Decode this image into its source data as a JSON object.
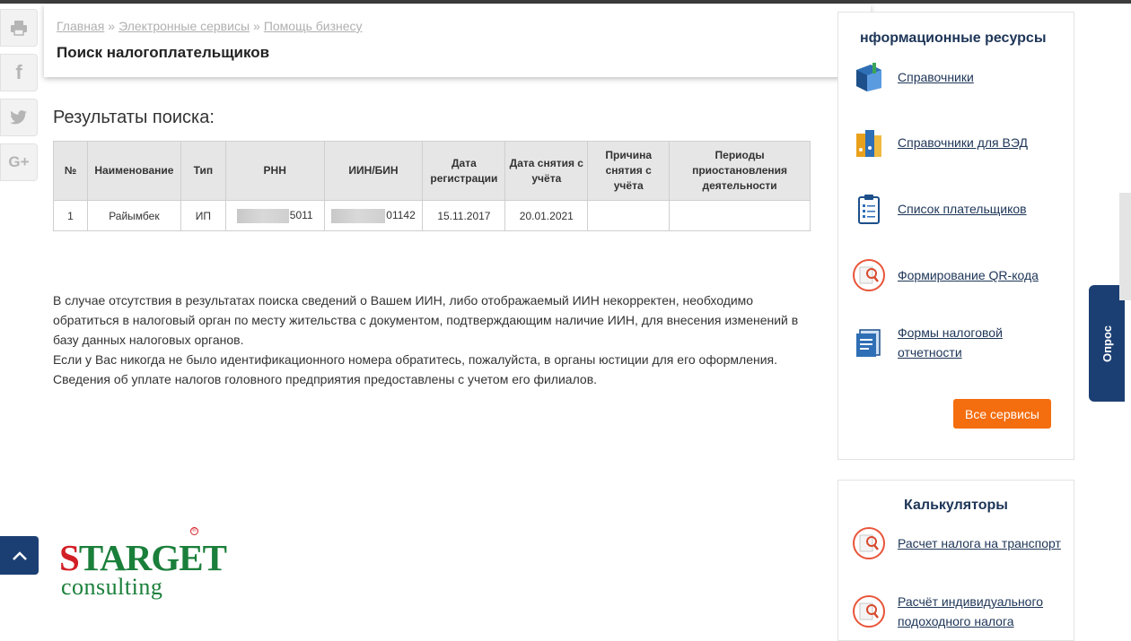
{
  "breadcrumb": {
    "items": [
      "Главная",
      "Электронные сервисы",
      "Помощь бизнесу"
    ],
    "separator": "»"
  },
  "page_title": "Поиск налогоплательщиков",
  "results_heading": "Результаты поиска:",
  "table": {
    "headers": [
      "№",
      "Наименование",
      "Тип",
      "РНН",
      "ИИН/БИН",
      "Дата регистрации",
      "Дата снятия с учёта",
      "Причина снятия с учёта",
      "Периоды приостановления деятельности"
    ],
    "rows": [
      {
        "num": "1",
        "name": "Райымбек",
        "type": "ИП",
        "rnn_visible": "5011",
        "iin_visible": "01142",
        "reg_date": "15.11.2017",
        "dereg_date": "20.01.2021",
        "reason": "",
        "periods": ""
      }
    ]
  },
  "notes": [
    "В случае отсутствия в результатах поиска сведений о Вашем ИИН, либо отображаемый ИИН некорректен, необходимо обратиться в налоговый орган по месту жительства с документом, подтверждающим наличие ИИН, для внесения изменений в базу данных налоговых органов.",
    "Если у Вас никогда не было идентификационного номера обратитесь, пожалуйста, в органы юстиции для его оформления.",
    "Сведения об уплате налогов головного предприятия предоставлены с учетом его филиалов."
  ],
  "sidebar": {
    "info_title": "нформационные ресурсы",
    "info_items": [
      {
        "label": "Справочники",
        "icon": "book-icon"
      },
      {
        "label": "Справочники для ВЭД",
        "icon": "binders-icon"
      },
      {
        "label": "Список плательщиков",
        "icon": "clipboard-icon"
      },
      {
        "label": "Формирование QR-кода",
        "icon": "magnifier-doc-icon"
      },
      {
        "label": "Формы налоговой отчетности",
        "icon": "forms-icon"
      }
    ],
    "all_services_label": "Все сервисы",
    "calc_title": "Калькуляторы",
    "calc_items": [
      {
        "label": "Расчет налога на транспорт",
        "icon": "magnifier-doc-icon"
      },
      {
        "label": "Расчёт индивидуального подоходного налога",
        "icon": "magnifier-doc-icon"
      }
    ]
  },
  "survey_tab": "Опрос",
  "share_icons": [
    "print-icon",
    "facebook-icon",
    "twitter-icon",
    "google-plus-icon"
  ],
  "logo": {
    "main": "STARGET",
    "sub": "consulting",
    "mark": "®"
  },
  "colors": {
    "navy": "#1c3f73",
    "orange": "#f46d0e",
    "link": "#1d3557",
    "logo_green": "#1a7f3a",
    "logo_red": "#d21f26"
  }
}
